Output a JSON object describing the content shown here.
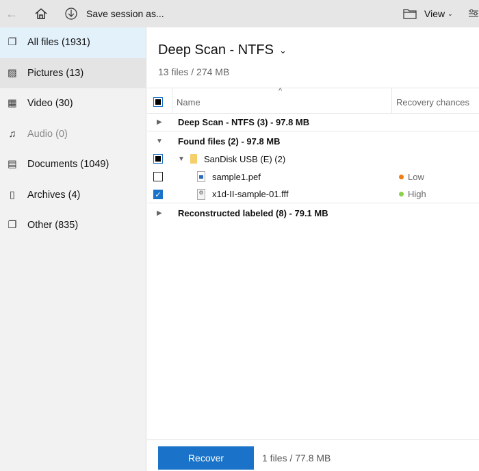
{
  "toolbar": {
    "save_label": "Save session as...",
    "view_label": "View"
  },
  "sidebar": {
    "items": [
      {
        "label": "All files (1931)",
        "icon": "all-files-icon"
      },
      {
        "label": "Pictures (13)",
        "icon": "pictures-icon"
      },
      {
        "label": "Video (30)",
        "icon": "video-icon"
      },
      {
        "label": "Audio (0)",
        "icon": "audio-icon"
      },
      {
        "label": "Documents (1049)",
        "icon": "documents-icon"
      },
      {
        "label": "Archives (4)",
        "icon": "archives-icon"
      },
      {
        "label": "Other (835)",
        "icon": "other-icon"
      }
    ]
  },
  "main": {
    "title": "Deep Scan - NTFS",
    "subtitle": "13 files / 274 MB",
    "columns": {
      "name": "Name",
      "recovery": "Recovery chances"
    },
    "rows": [
      {
        "label": "Deep Scan - NTFS (3) - 97.8 MB"
      },
      {
        "label": "Found files (2) - 97.8 MB"
      },
      {
        "label": "SanDisk USB (E) (2)"
      },
      {
        "label": "sample1.pef",
        "chance": "Low",
        "color": "#f07d14"
      },
      {
        "label": "x1d-II-sample-01.fff",
        "chance": "High",
        "color": "#8ccf4d"
      },
      {
        "label": "Reconstructed labeled (8) - 79.1 MB"
      }
    ]
  },
  "footer": {
    "recover_label": "Recover",
    "summary": "1 files / 77.8 MB"
  }
}
